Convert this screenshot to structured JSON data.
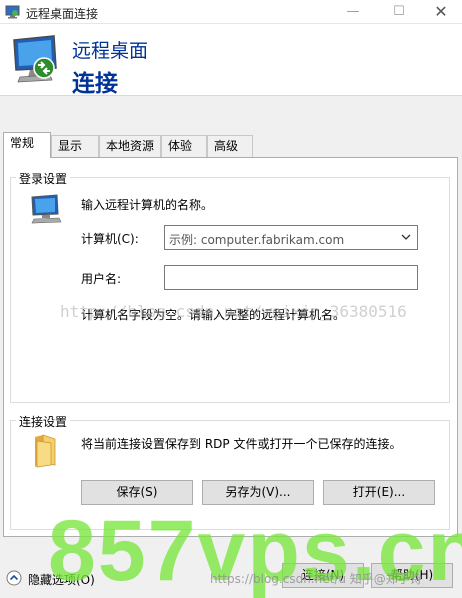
{
  "window": {
    "title": "远程桌面连接",
    "minimize_glyph": "—",
    "maximize_glyph": "☐",
    "close_glyph": "✕"
  },
  "banner": {
    "line1": "远程桌面",
    "line2": "连接"
  },
  "tabs": [
    {
      "label": "常规",
      "active": true
    },
    {
      "label": "显示",
      "active": false
    },
    {
      "label": "本地资源",
      "active": false
    },
    {
      "label": "体验",
      "active": false
    },
    {
      "label": "高级",
      "active": false
    }
  ],
  "login": {
    "group_title": "登录设置",
    "instruction": "输入远程计算机的名称。",
    "computer_label": "计算机(C):",
    "computer_value": "示例: computer.fabrikam.com",
    "username_label": "用户名:",
    "username_value": "",
    "hint": "计算机名字段为空。请输入完整的远程计算机名。"
  },
  "connection": {
    "group_title": "连接设置",
    "description": "将当前连接设置保存到 RDP 文件或打开一个已保存的连接。",
    "save_label": "保存(S)",
    "save_as_label": "另存为(V)...",
    "open_label": "打开(E)..."
  },
  "footer": {
    "hide_options_label": "隐藏选项(O)",
    "connect_label": "连接(N)",
    "help_label": "帮助(H)"
  },
  "watermarks": {
    "blog": "http://blog.csdn.net/weixin_36380516",
    "big": "857vps.cn",
    "small": "https://blog.csdn.net/u 知乎@郑孑诗"
  },
  "colors": {
    "banner_text": "#003399",
    "window_bg": "#f0f0f0"
  },
  "icons": {
    "app": "remote-desktop-icon",
    "hero": "remote-desktop-icon",
    "computer": "computer-icon",
    "folder": "folder-icon",
    "chevron": "chevron-up-icon"
  }
}
